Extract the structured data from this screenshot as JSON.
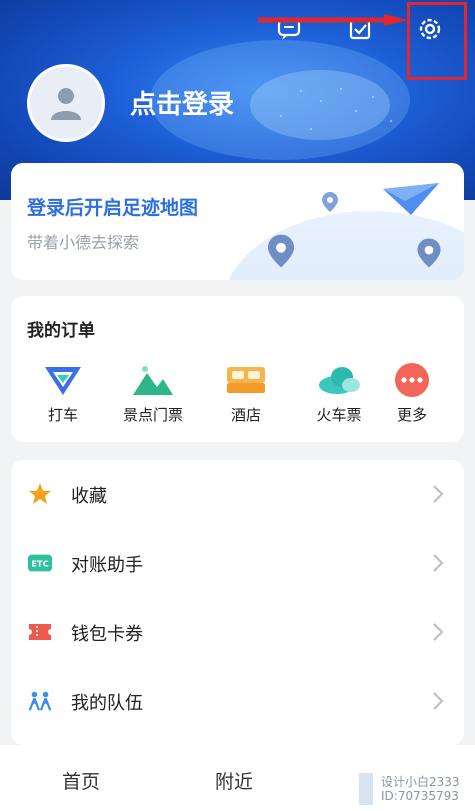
{
  "header": {
    "login_text": "点击登录"
  },
  "footprint_card": {
    "title": "登录后开启足迹地图",
    "subtitle": "带着小德去探索"
  },
  "orders": {
    "title": "我的订单",
    "items": [
      {
        "label": "打车",
        "icon": "taxi-icon",
        "color": "#3b6fe8"
      },
      {
        "label": "景点门票",
        "icon": "mountain-icon",
        "color": "#2fb58a"
      },
      {
        "label": "酒店",
        "icon": "bed-icon",
        "color": "#f39b2b"
      },
      {
        "label": "火车票",
        "icon": "cloud-icon",
        "color": "#2db8b0"
      },
      {
        "label": "更多",
        "icon": "more-icon",
        "color": "#f2655a"
      }
    ]
  },
  "menu": {
    "items": [
      {
        "label": "收藏",
        "icon": "star-icon",
        "color": "#f5a11c"
      },
      {
        "label": "对账助手",
        "icon": "etc-icon",
        "icon_text": "ETC",
        "color": "#2ec1a0"
      },
      {
        "label": "钱包卡券",
        "icon": "ticket-icon",
        "color": "#ef5a50"
      },
      {
        "label": "我的队伍",
        "icon": "team-icon",
        "color": "#3b8ee8"
      }
    ]
  },
  "tabbar": {
    "tabs": [
      {
        "label": "首页"
      },
      {
        "label": "附近"
      }
    ]
  },
  "watermark": {
    "line1": "设计小白2333",
    "line2": "ID:70735793"
  }
}
